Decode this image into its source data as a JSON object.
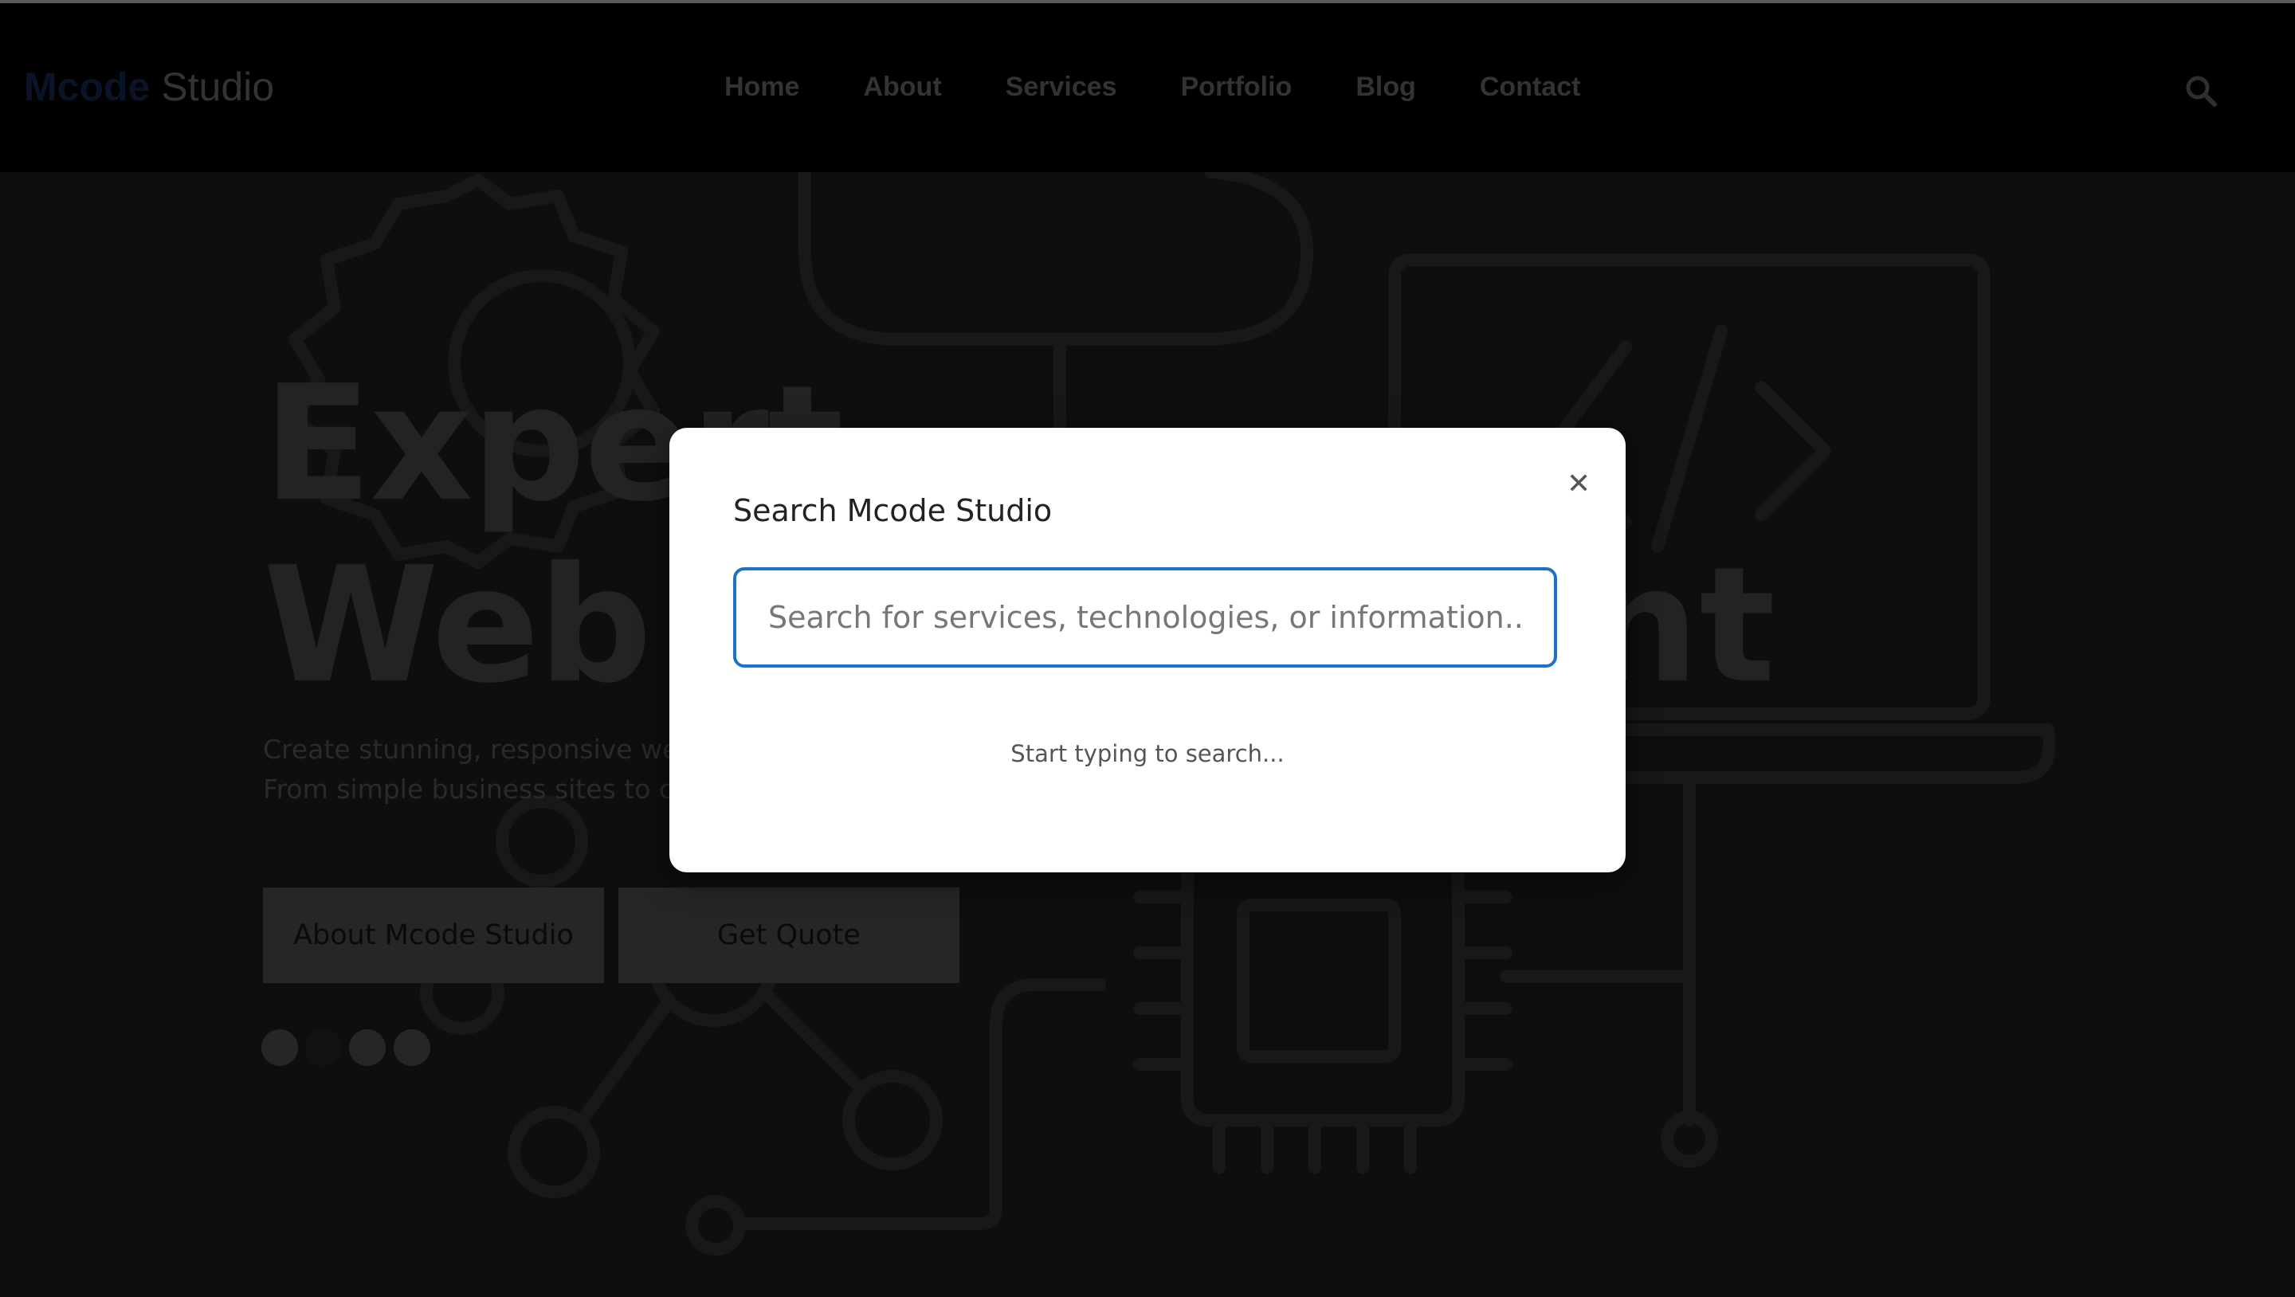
{
  "navbar": {
    "logo_accent": "Mcode",
    "logo_rest": "Studio",
    "links": [
      "Home",
      "About",
      "Services",
      "Portfolio",
      "Blog",
      "Contact"
    ],
    "search_icon": "search-icon"
  },
  "hero": {
    "title_line1": "Expert",
    "title_line2": "Web",
    "title_line2_tail": "nt",
    "subtitle_line1": "Create stunning, responsive web",
    "subtitle_line2": "From simple business sites to co",
    "buttons": [
      "About Mcode Studio",
      "Get Quote"
    ],
    "slide_dots": 4
  },
  "search_modal": {
    "title": "Search Mcode Studio",
    "close_icon": "close-icon",
    "input_placeholder": "Search for services, technologies, or information...",
    "input_value": "",
    "hint": "Start typing to search..."
  },
  "colors": {
    "accent": "#1a73c9",
    "page_bg": "#0b0b0b",
    "modal_bg": "#ffffff"
  }
}
